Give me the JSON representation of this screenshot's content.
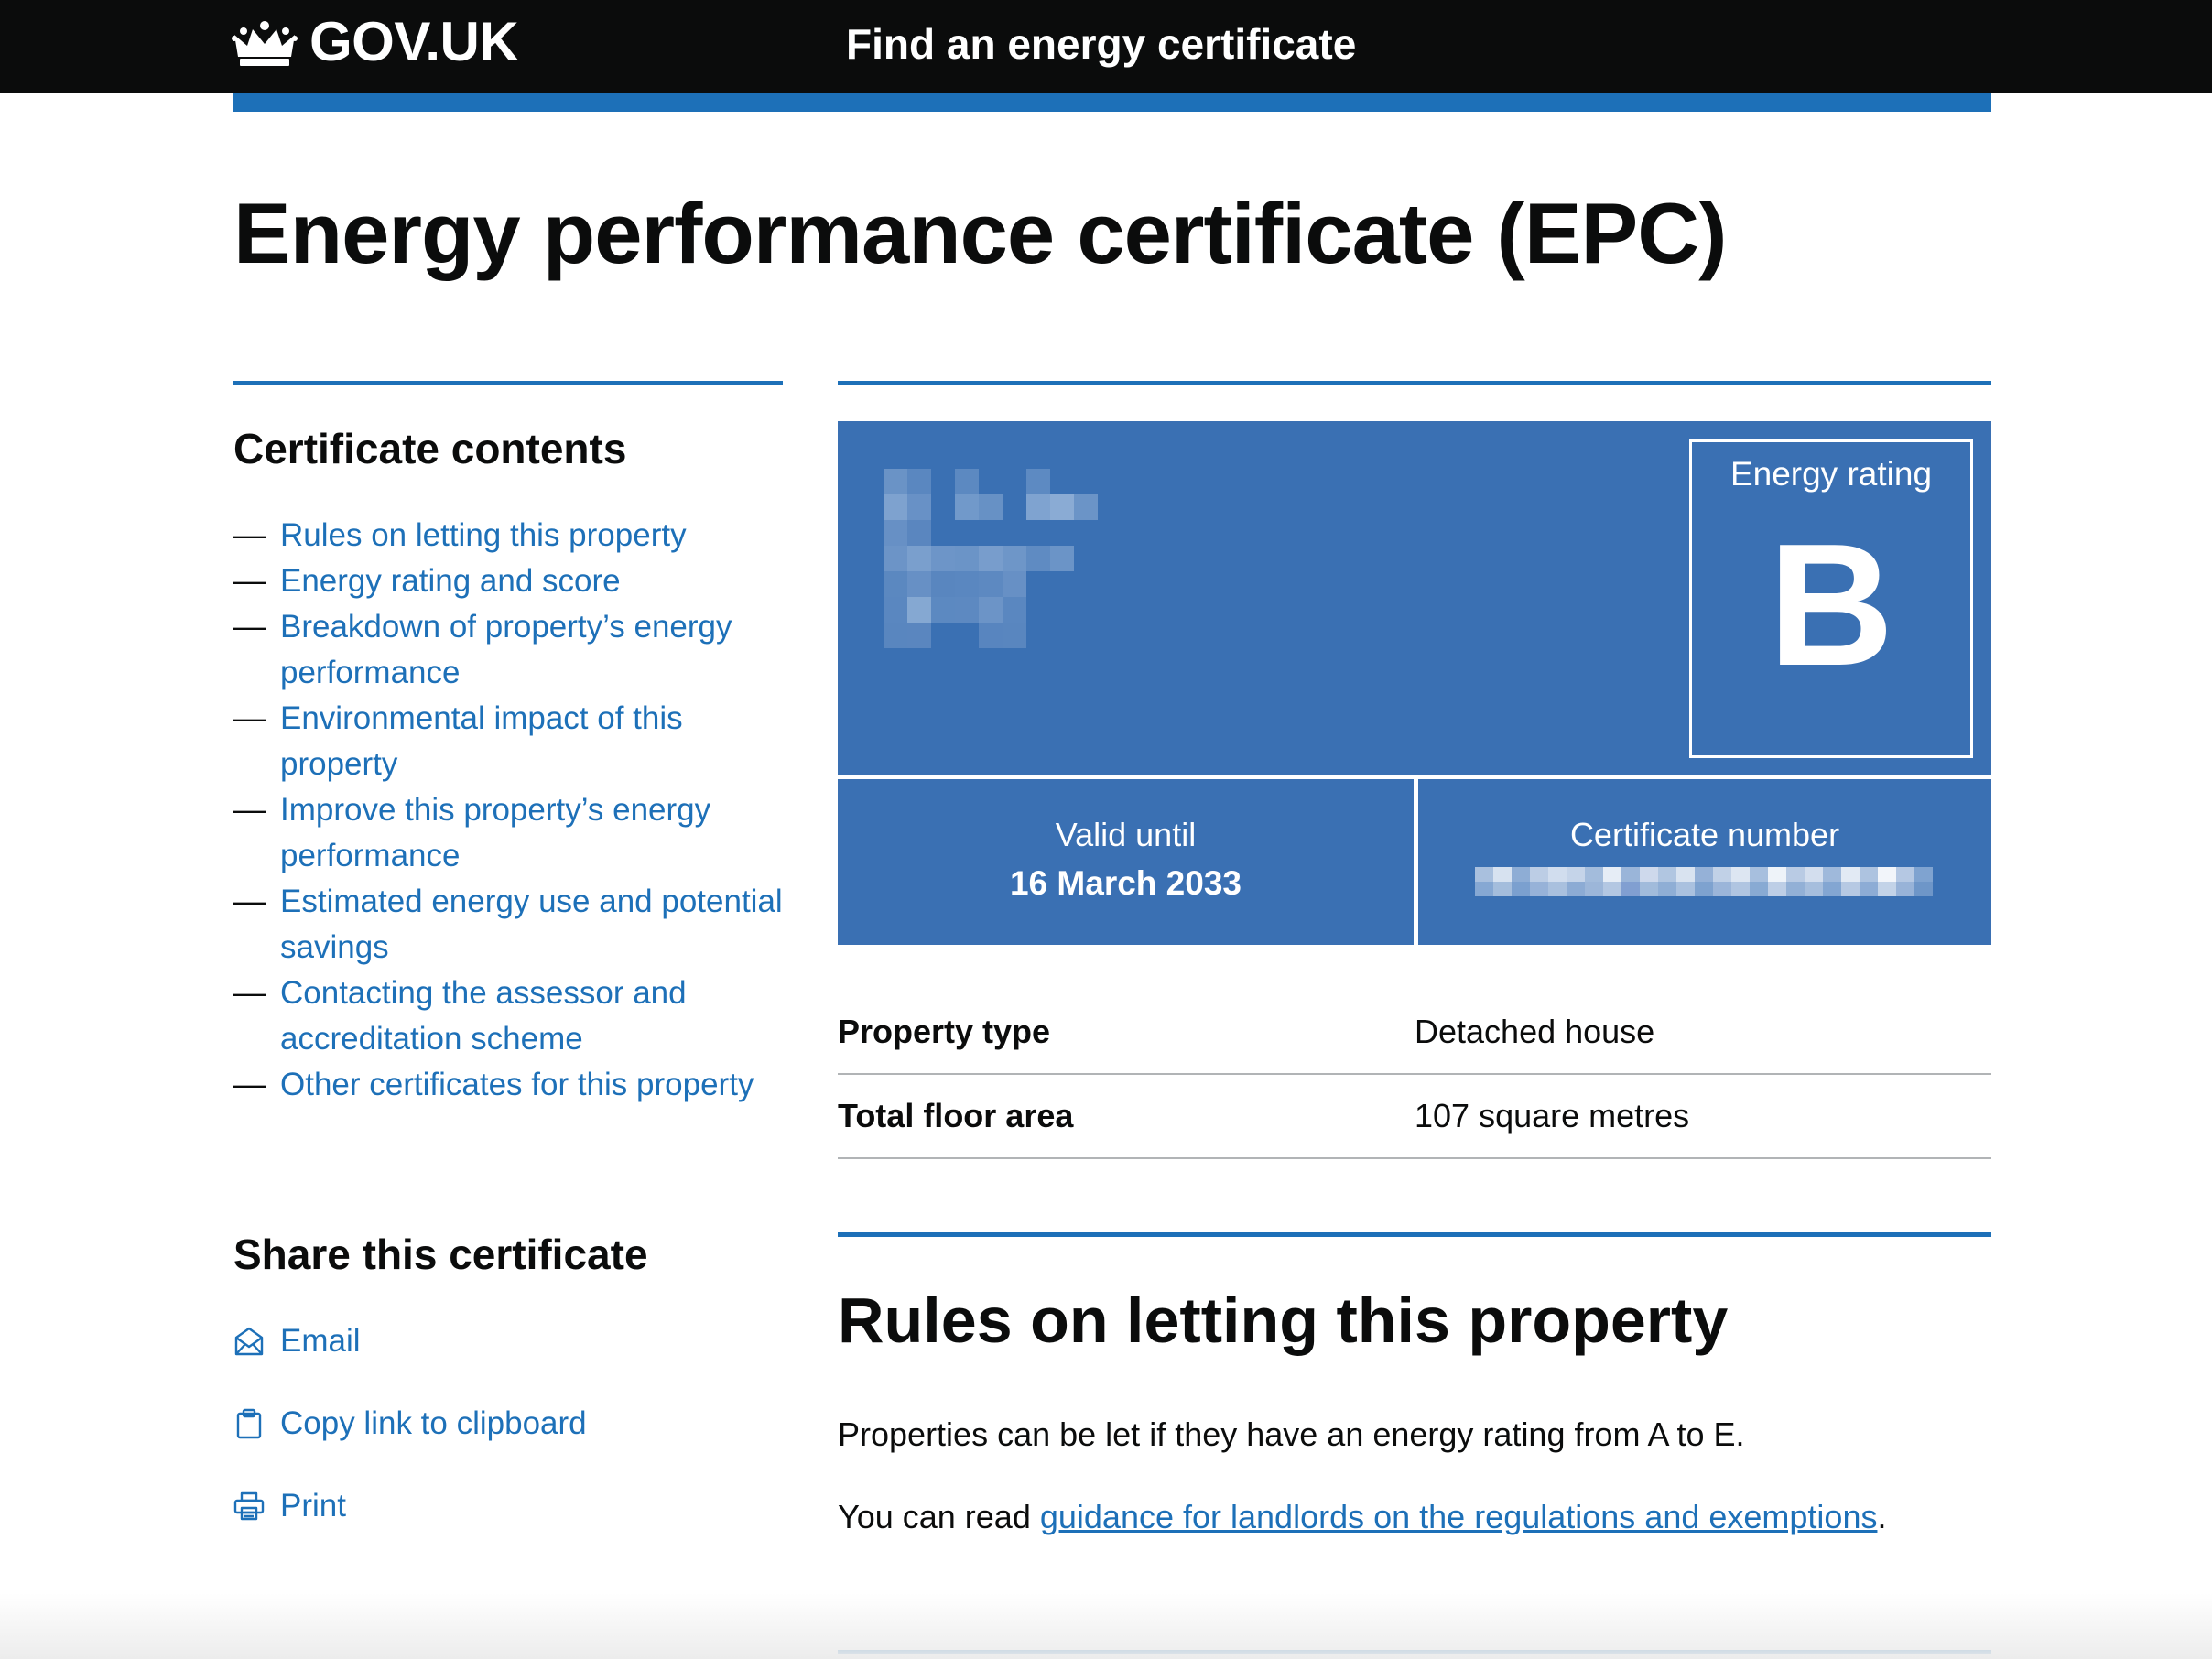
{
  "header": {
    "logo_text": "GOV.UK",
    "service_name": "Find an energy certificate"
  },
  "page": {
    "title": "Energy performance certificate (EPC)"
  },
  "sidebar": {
    "contents_heading": "Certificate contents",
    "contents_items": [
      {
        "label": "Rules on letting this property"
      },
      {
        "label": "Energy rating and score"
      },
      {
        "label": "Breakdown of property’s energy performance"
      },
      {
        "label": "Environmental impact of this property"
      },
      {
        "label": "Improve this property’s energy performance"
      },
      {
        "label": "Estimated energy use and potential savings"
      },
      {
        "label": "Contacting the assessor and accreditation scheme"
      },
      {
        "label": "Other certificates for this property"
      }
    ],
    "dash": "—",
    "share_heading": "Share this certificate",
    "share_items": {
      "email": "Email",
      "copy_link": "Copy link to clipboard",
      "print": "Print"
    }
  },
  "certificate": {
    "rating_label": "Energy rating",
    "rating_value": "B",
    "valid_until_label": "Valid until",
    "valid_until_value": "16 March 2033",
    "certificate_number_label": "Certificate number"
  },
  "summary": {
    "rows": [
      {
        "key": "Property type",
        "value": "Detached house"
      },
      {
        "key": "Total floor area",
        "value": "107 square metres"
      }
    ]
  },
  "letting_section": {
    "heading": "Rules on letting this property",
    "paragraph1": "Properties can be let if they have an energy rating from A to E.",
    "paragraph2_prefix": "You can read ",
    "paragraph2_link": "guidance for landlords on the regulations and exemptions",
    "paragraph2_suffix": "."
  },
  "colors": {
    "header_bg": "#0b0c0c",
    "accent_blue": "#1d70b8",
    "certificate_blue": "#3a70b3",
    "text": "#0b0c0c"
  }
}
